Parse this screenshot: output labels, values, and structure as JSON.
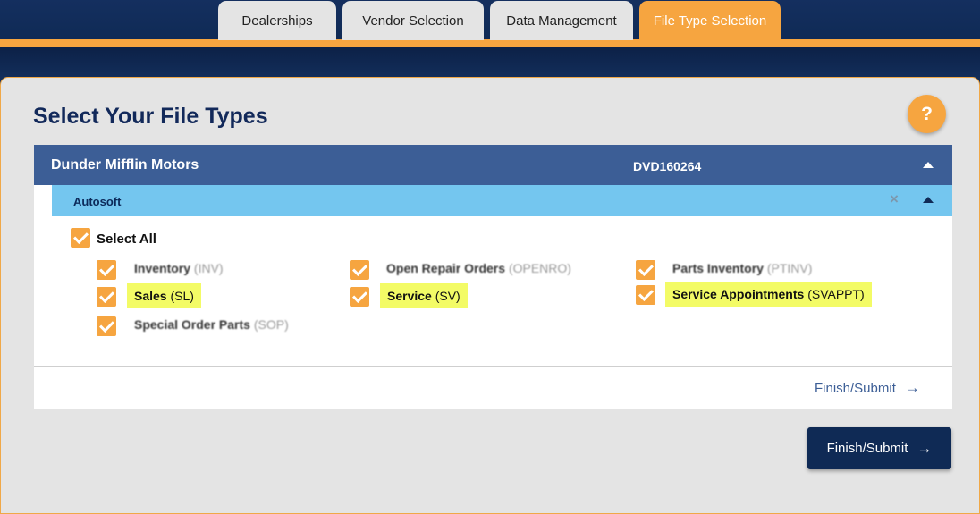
{
  "tabs": [
    {
      "label": "Dealerships",
      "active": false
    },
    {
      "label": "Vendor Selection",
      "active": false
    },
    {
      "label": "Data Management",
      "active": false
    },
    {
      "label": "File Type Selection",
      "active": true
    }
  ],
  "page": {
    "title": "Select Your File Types",
    "help_label": "?"
  },
  "dealer": {
    "name": "Dunder Mifflin Motors",
    "id": "DVD160264"
  },
  "vendor": {
    "name": "Autosoft",
    "close_icon": "×"
  },
  "select_all": {
    "label": "Select All",
    "checked": true
  },
  "file_types": [
    {
      "name": "Inventory",
      "code": "(INV)",
      "checked": true,
      "highlighted": false,
      "blurred": true
    },
    {
      "name": "Open Repair Orders",
      "code": "(OPENRO)",
      "checked": true,
      "highlighted": false,
      "blurred": true
    },
    {
      "name": "Parts Inventory",
      "code": "(PTINV)",
      "checked": true,
      "highlighted": false,
      "blurred": true
    },
    {
      "name": "Sales",
      "code": "(SL)",
      "checked": true,
      "highlighted": true,
      "blurred": false
    },
    {
      "name": "Service",
      "code": "(SV)",
      "checked": true,
      "highlighted": true,
      "blurred": false
    },
    {
      "name": "Service Appointments",
      "code": "(SVAPPT)",
      "checked": true,
      "highlighted": true,
      "blurred": false
    },
    {
      "name": "Special Order Parts",
      "code": "(SOP)",
      "checked": true,
      "highlighted": false,
      "blurred": true
    }
  ],
  "actions": {
    "finish_link_label": "Finish/Submit",
    "finish_button_label": "Finish/Submit",
    "arrow_icon": "→"
  },
  "colors": {
    "navy": "#0f2a55",
    "orange": "#f6a540",
    "dealer_bar": "#3c5e96",
    "vendor_bar": "#74c6ef",
    "highlight": "#f3fb66"
  }
}
